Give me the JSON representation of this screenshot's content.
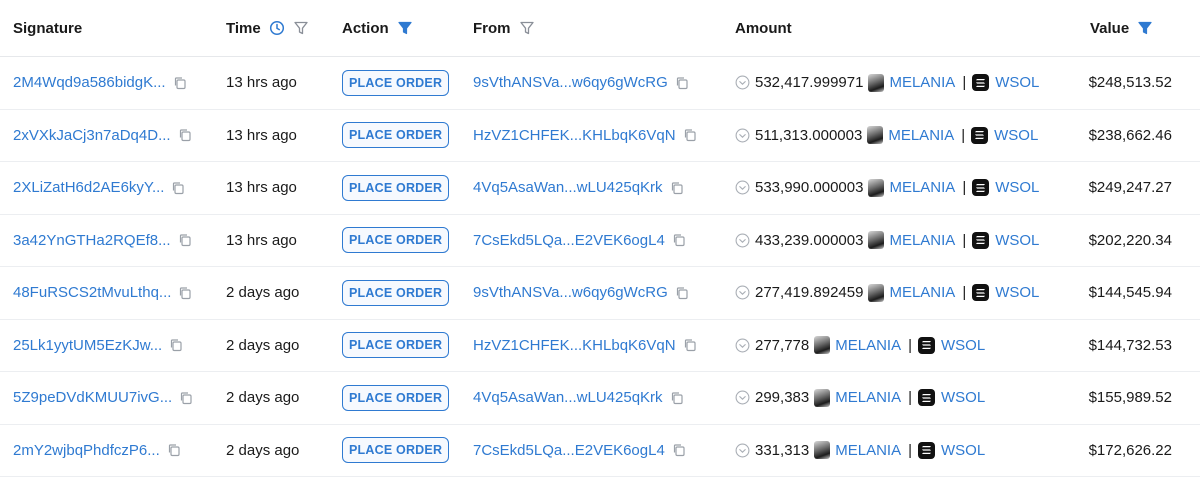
{
  "header": {
    "signature": "Signature",
    "time": "Time",
    "action": "Action",
    "from": "From",
    "amount": "Amount",
    "value": "Value"
  },
  "colors": {
    "link": "#2f7ad1",
    "text": "#1a1a1a",
    "divider": "#eceef1"
  },
  "icons": {
    "copy": "copy-icon",
    "clock": "clock-icon",
    "filter": "filter-icon",
    "status": "check-circle-icon",
    "token_a": "melania-avatar-icon",
    "token_b": "solana-icon"
  },
  "rows": [
    {
      "signature": "2M4Wqd9a586bidgK...",
      "time": "13 hrs ago",
      "action": "PLACE ORDER",
      "from": "9sVthANSVa...w6qy6gWcRG",
      "amount": "532,417.999971",
      "token_a": "MELANIA",
      "sep": "|",
      "token_b": "WSOL",
      "value": "$248,513.52"
    },
    {
      "signature": "2xVXkJaCj3n7aDq4D...",
      "time": "13 hrs ago",
      "action": "PLACE ORDER",
      "from": "HzVZ1CHFEK...KHLbqK6VqN",
      "amount": "511,313.000003",
      "token_a": "MELANIA",
      "sep": "|",
      "token_b": "WSOL",
      "value": "$238,662.46"
    },
    {
      "signature": "2XLiZatH6d2AE6kyY...",
      "time": "13 hrs ago",
      "action": "PLACE ORDER",
      "from": "4Vq5AsaWan...wLU425qKrk",
      "amount": "533,990.000003",
      "token_a": "MELANIA",
      "sep": "|",
      "token_b": "WSOL",
      "value": "$249,247.27"
    },
    {
      "signature": "3a42YnGTHa2RQEf8...",
      "time": "13 hrs ago",
      "action": "PLACE ORDER",
      "from": "7CsEkd5LQa...E2VEK6ogL4",
      "amount": "433,239.000003",
      "token_a": "MELANIA",
      "sep": "|",
      "token_b": "WSOL",
      "value": "$202,220.34"
    },
    {
      "signature": "48FuRSCS2tMvuLthq...",
      "time": "2 days ago",
      "action": "PLACE ORDER",
      "from": "9sVthANSVa...w6qy6gWcRG",
      "amount": "277,419.892459",
      "token_a": "MELANIA",
      "sep": "|",
      "token_b": "WSOL",
      "value": "$144,545.94"
    },
    {
      "signature": "25Lk1yytUM5EzKJw...",
      "time": "2 days ago",
      "action": "PLACE ORDER",
      "from": "HzVZ1CHFEK...KHLbqK6VqN",
      "amount": "277,778",
      "token_a": "MELANIA",
      "sep": "|",
      "token_b": "WSOL",
      "value": "$144,732.53"
    },
    {
      "signature": "5Z9peDVdKMUU7ivG...",
      "time": "2 days ago",
      "action": "PLACE ORDER",
      "from": "4Vq5AsaWan...wLU425qKrk",
      "amount": "299,383",
      "token_a": "MELANIA",
      "sep": "|",
      "token_b": "WSOL",
      "value": "$155,989.52"
    },
    {
      "signature": "2mY2wjbqPhdfczP6...",
      "time": "2 days ago",
      "action": "PLACE ORDER",
      "from": "7CsEkd5LQa...E2VEK6ogL4",
      "amount": "331,313",
      "token_a": "MELANIA",
      "sep": "|",
      "token_b": "WSOL",
      "value": "$172,626.22"
    }
  ]
}
